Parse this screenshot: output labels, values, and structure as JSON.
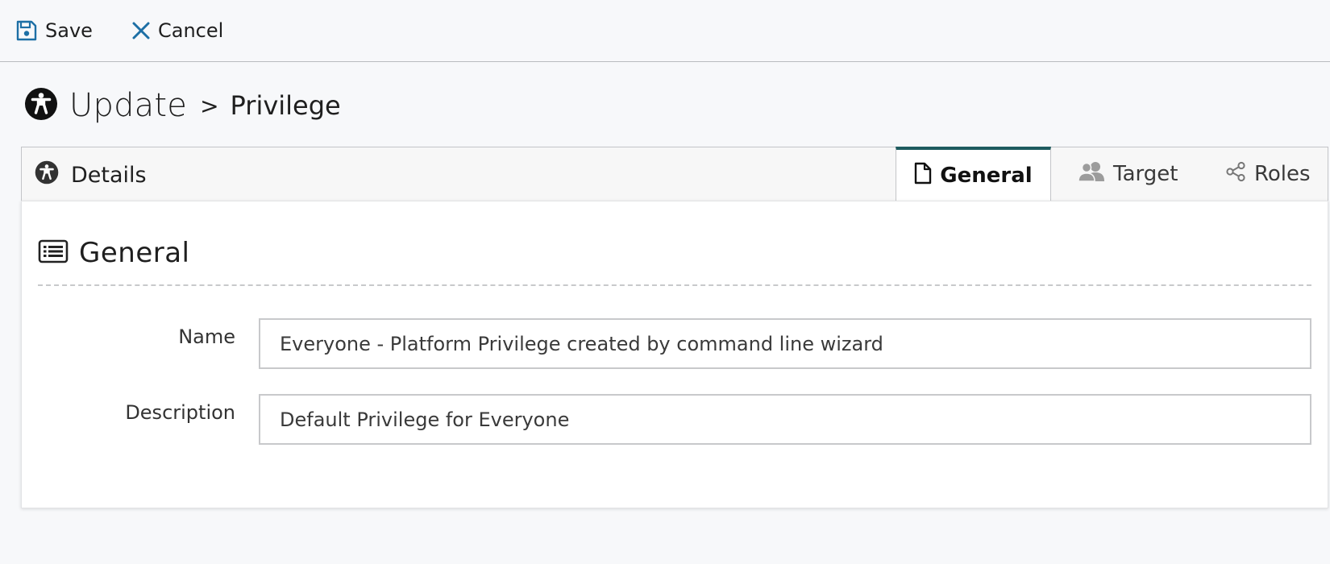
{
  "toolbar": {
    "save_label": "Save",
    "cancel_label": "Cancel"
  },
  "header": {
    "title": "Update",
    "separator": ">",
    "subtitle": "Privilege",
    "icon": "accessibility-icon"
  },
  "tabbar": {
    "details_label": "Details",
    "tabs": [
      {
        "label": "General",
        "icon": "document-icon",
        "active": true
      },
      {
        "label": "Target",
        "icon": "users-icon",
        "active": false
      },
      {
        "label": "Roles",
        "icon": "share-nodes-icon",
        "active": false
      }
    ]
  },
  "section": {
    "title": "General",
    "icon": "list-icon"
  },
  "form": {
    "name_label": "Name",
    "name_value": "Everyone - Platform Privilege created by command line wizard",
    "description_label": "Description",
    "description_value": "Default Privilege for Everyone"
  },
  "colors": {
    "accent": "#1e5b5f",
    "icon_blue": "#1d6fa5",
    "background": "#f7f8fa"
  }
}
